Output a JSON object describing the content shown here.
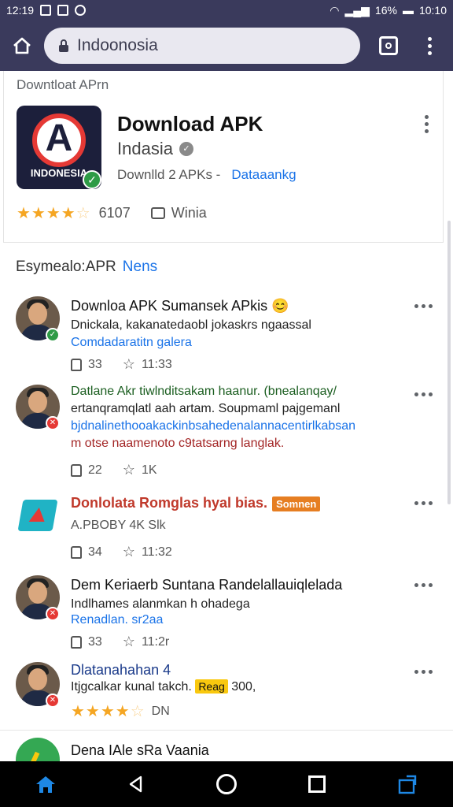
{
  "status_bar": {
    "time_left": "12:19",
    "battery": "16%",
    "time_right": "10:10"
  },
  "browser": {
    "url": "Indoonosia"
  },
  "app_card": {
    "heading": "Downtloat APrn",
    "logo_text": "INDONESIA",
    "title": "Download APK",
    "developer": "Indasia",
    "meta_downloads": "Downlld 2 APKs -",
    "meta_link": "Dataaankg",
    "rating_count": "6107",
    "comment_label": "Winia"
  },
  "section": {
    "title": "Esymealo:APR",
    "link": "Nens"
  },
  "feed": [
    {
      "title": "Downloa APK Sumansek APkis 😊",
      "line1": "Dnickala, kakanatedaobl jokaskrs ngaassal",
      "line2": "Comdadaratitn galera",
      "likes": "33",
      "stars": "11:33"
    },
    {
      "title": "Datlane Akr tiwlnditsakam haanur. (bnealanqay/",
      "line1": "ertanqramqlatl aah artam. Soupmaml pajgemanl",
      "line2": "bjdnalinethooakackinbsahedenalannacentirlkabsan",
      "line3": "m otse naamenoto c9tatsarng langlak.",
      "likes": "22",
      "stars": "1K"
    },
    {
      "title": "Donlolata Romglas hyal bias.",
      "tag": "Somnen",
      "line1": "A.PBOBY 4K Slk",
      "likes": "34",
      "stars": "11:32"
    },
    {
      "title": "Dem Keriaerb Suntana Randelallauiqlelada",
      "line1": "Indlhames alanmkan h ohadega",
      "line2": "Renadlan. sr2aa",
      "likes": "33",
      "stars": "11:2r"
    },
    {
      "title": "Dlatanahahan 4",
      "line1": "Itjgcalkar kunal takch.",
      "tag": "Reag",
      "line1_end": "300,",
      "rating_label": "DN"
    },
    {
      "title": "Dena IAle sRa Vaania"
    }
  ]
}
